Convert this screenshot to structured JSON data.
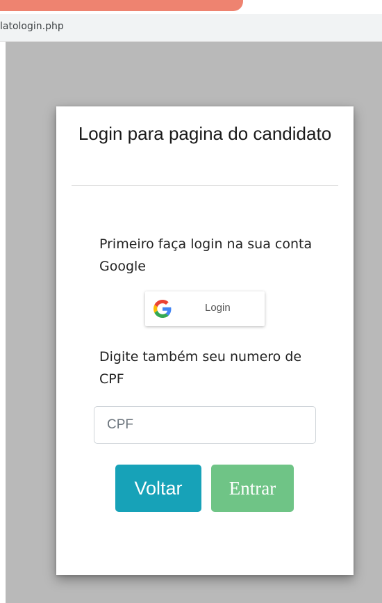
{
  "browser": {
    "url": "latologin.php",
    "tab_accent_color": "#ee8370"
  },
  "card": {
    "title": "Login para pagina do candidato",
    "google_instruction": "Primeiro faça login na sua conta Google",
    "google_button": {
      "label": "Login",
      "icon": "google-g-icon"
    },
    "cpf_instruction": "Digite também seu numero de CPF",
    "cpf_input": {
      "placeholder": "CPF",
      "value": ""
    },
    "buttons": {
      "back_label": "Voltar",
      "submit_label": "Entrar"
    }
  },
  "colors": {
    "backdrop": "#b9b9b9",
    "back_button": "#17a2b8",
    "submit_button": "#6fc486"
  }
}
